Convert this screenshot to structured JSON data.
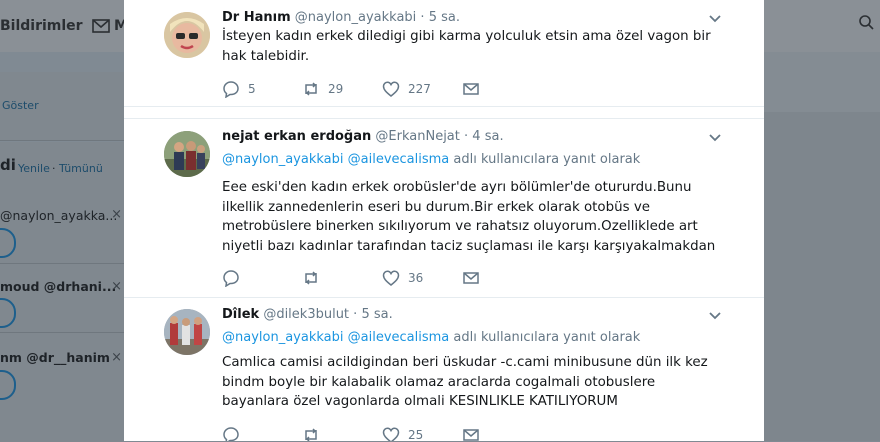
{
  "background": {
    "nav": {
      "notifications_label": "Bildirimler",
      "messages_label": "M"
    },
    "left_panel": {
      "show_link": "Göster",
      "who_to_follow_partial": "di",
      "refresh_link": "Yenile",
      "all_link": "Tümünü",
      "dot": "·",
      "suggestions": [
        {
          "text": "@naylon_ayakka..."
        },
        {
          "text": "moud @drhani..."
        },
        {
          "text": "nm @dr__hanim"
        }
      ],
      "dismiss_glyph": "×"
    }
  },
  "tweets": [
    {
      "name": "Dr Hanım",
      "handle": "@naylon_ayakkabi",
      "time": "5 sa.",
      "separator": "·",
      "reply_to": null,
      "body": "İsteyen kadın erkek diledigi gibi karma yolculuk etsin ama özel vagon bir hak talebidir.",
      "replies": "5",
      "retweets": "29",
      "likes": "227"
    },
    {
      "name": "nejat erkan erdoğan",
      "handle": "@ErkanNejat",
      "time": "4 sa.",
      "separator": "·",
      "reply_to": {
        "mention1": "@naylon_ayakkabi",
        "mention2": "@ailevecalisma",
        "suffix": "adlı kullanıcılara yanıt olarak"
      },
      "body": "Eee eski'den kadın erkek orobüsler'de ayrı bölümler'de otururdu.Bunu ilkellik zannedenlerin eseri bu durum.Bir erkek olarak otobüs ve metrobüslere binerken sıkılıyorum ve rahatsız oluyorum.Ozelliklede art niyetli bazı kadınlar tarafından taciz suçlaması ile karşı karşıyakalmakdan",
      "replies": "",
      "retweets": "",
      "likes": "36"
    },
    {
      "name": "Dîlek",
      "handle": "@dilek3bulut",
      "time": "5 sa.",
      "separator": "·",
      "reply_to": {
        "mention1": "@naylon_ayakkabi",
        "mention2": "@ailevecalisma",
        "suffix": "adlı kullanıcılara yanıt olarak"
      },
      "body": "Camlica camisi acildigindan beri üskudar -c.cami minibusune dün ilk kez bindm boyle bir kalabalik olamaz araclarda cogalmali otobuslere bayanlara özel vagonlarda olmali  KESINLIKLE KATILIYORUM",
      "replies": "",
      "retweets": "",
      "likes": "25"
    }
  ],
  "colors": {
    "link": "#1b95e0",
    "muted": "#657786",
    "text": "#14171a",
    "overlay": "#808a93"
  }
}
